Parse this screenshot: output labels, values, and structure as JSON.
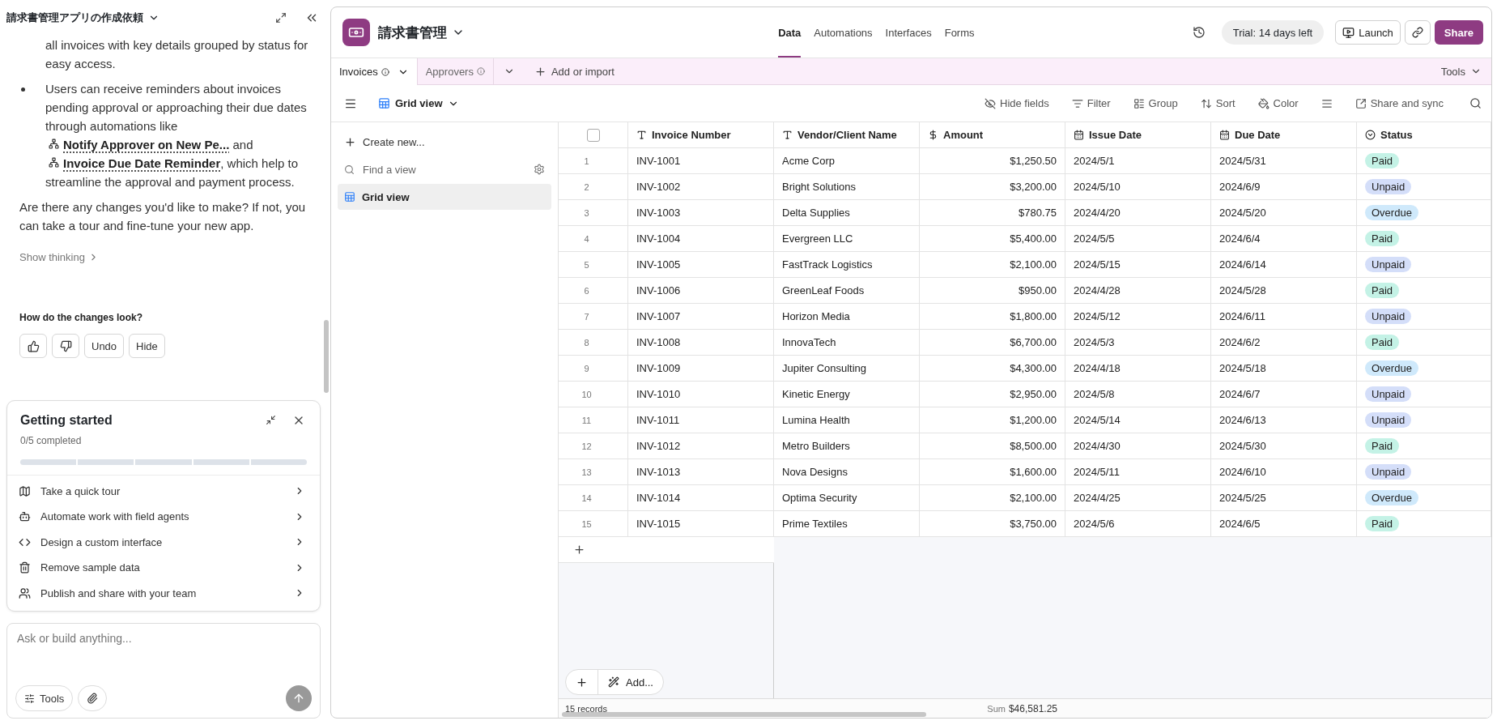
{
  "chat": {
    "title": "請求書管理アプリの作成依頼",
    "continuation_text": "all invoices with key details grouped by status for easy access.",
    "bullet": [
      {
        "kind": "text",
        "text": "Users can receive reminders about invoices pending approval or approaching their due dates through automations like "
      },
      {
        "kind": "link",
        "text": "Notify Approver on New Pe..."
      },
      {
        "kind": "text",
        "text": " and "
      },
      {
        "kind": "link",
        "text": "Invoice Due Date Reminder"
      },
      {
        "kind": "text",
        "text": ", which help to streamline the approval and payment process."
      }
    ],
    "closing": "Are there any changes you'd like to make? If not, you can take a tour and fine-tune your new app.",
    "show_thinking": "Show thinking",
    "feedback_question": "How do the changes look?",
    "feedback_buttons": [
      {
        "kind": "thumbs-up"
      },
      {
        "kind": "thumbs-down"
      },
      {
        "kind": "text",
        "label": "Undo"
      },
      {
        "kind": "text",
        "label": "Hide"
      }
    ]
  },
  "getting_started": {
    "title": "Getting started",
    "progress": "0/5 completed",
    "steps": [
      {
        "kind": "map",
        "label": "Take a quick tour",
        "done": false
      },
      {
        "kind": "bot",
        "label": "Automate work with field agents",
        "done": false
      },
      {
        "kind": "code",
        "label": "Design a custom interface",
        "done": false
      },
      {
        "kind": "trash",
        "label": "Remove sample data",
        "done": false
      },
      {
        "kind": "team",
        "label": "Publish and share with your team",
        "done": false
      }
    ]
  },
  "composer": {
    "placeholder": "Ask or build anything...",
    "tools": "Tools"
  },
  "app": {
    "name": "請求書管理",
    "nav": [
      {
        "label": "Data",
        "selected": true
      },
      {
        "label": "Automations",
        "selected": false
      },
      {
        "label": "Interfaces",
        "selected": false
      },
      {
        "label": "Forms",
        "selected": false
      }
    ],
    "trial": "Trial: 14 days left",
    "launch": "Launch",
    "share": "Share"
  },
  "tables": [
    {
      "label": "Invoices",
      "selected": true
    },
    {
      "label": "Approvers",
      "selected": false
    }
  ],
  "add_or_import": "Add or import",
  "tools": "Tools",
  "toolbar": {
    "view": "Grid view",
    "actions": [
      {
        "kind": "hide",
        "label": "Hide fields"
      },
      {
        "kind": "filter",
        "label": "Filter"
      },
      {
        "kind": "group",
        "label": "Group"
      },
      {
        "kind": "sort",
        "label": "Sort"
      },
      {
        "kind": "color",
        "label": "Color"
      },
      {
        "kind": "height"
      },
      {
        "kind": "share",
        "label": "Share and sync"
      }
    ]
  },
  "views": {
    "create": "Create new...",
    "search_placeholder": "Find a view",
    "items": [
      {
        "label": "Grid view",
        "selected": true
      }
    ]
  },
  "grid": {
    "select_all_checked": false,
    "columns": [
      {
        "kind": "text",
        "label": "Invoice Number"
      },
      {
        "kind": "text",
        "label": "Vendor/Client Name"
      },
      {
        "kind": "currency",
        "label": "Amount"
      },
      {
        "kind": "date",
        "label": "Issue Date"
      },
      {
        "kind": "date",
        "label": "Due Date"
      },
      {
        "kind": "status",
        "label": "Status"
      }
    ],
    "rows": [
      {
        "n": "1",
        "cells": [
          "INV-1001",
          "Acme Corp",
          "$1,250.50",
          "2024/5/1",
          "2024/5/31"
        ],
        "status": {
          "label": "Paid",
          "color": "#c4f2e6"
        }
      },
      {
        "n": "2",
        "cells": [
          "INV-1002",
          "Bright Solutions",
          "$3,200.00",
          "2024/5/10",
          "2024/6/9"
        ],
        "status": {
          "label": "Unpaid",
          "color": "#d4def9"
        }
      },
      {
        "n": "3",
        "cells": [
          "INV-1003",
          "Delta Supplies",
          "$780.75",
          "2024/4/20",
          "2024/5/20"
        ],
        "status": {
          "label": "Overdue",
          "color": "#cfe9fb"
        }
      },
      {
        "n": "4",
        "cells": [
          "INV-1004",
          "Evergreen LLC",
          "$5,400.00",
          "2024/5/5",
          "2024/6/4"
        ],
        "status": {
          "label": "Paid",
          "color": "#c4f2e6"
        }
      },
      {
        "n": "5",
        "cells": [
          "INV-1005",
          "FastTrack Logistics",
          "$2,100.00",
          "2024/5/15",
          "2024/6/14"
        ],
        "status": {
          "label": "Unpaid",
          "color": "#d4def9"
        }
      },
      {
        "n": "6",
        "cells": [
          "INV-1006",
          "GreenLeaf Foods",
          "$950.00",
          "2024/4/28",
          "2024/5/28"
        ],
        "status": {
          "label": "Paid",
          "color": "#c4f2e6"
        }
      },
      {
        "n": "7",
        "cells": [
          "INV-1007",
          "Horizon Media",
          "$1,800.00",
          "2024/5/12",
          "2024/6/11"
        ],
        "status": {
          "label": "Unpaid",
          "color": "#d4def9"
        }
      },
      {
        "n": "8",
        "cells": [
          "INV-1008",
          "InnovaTech",
          "$6,700.00",
          "2024/5/3",
          "2024/6/2"
        ],
        "status": {
          "label": "Paid",
          "color": "#c4f2e6"
        }
      },
      {
        "n": "9",
        "cells": [
          "INV-1009",
          "Jupiter Consulting",
          "$4,300.00",
          "2024/4/18",
          "2024/5/18"
        ],
        "status": {
          "label": "Overdue",
          "color": "#cfe9fb"
        }
      },
      {
        "n": "10",
        "cells": [
          "INV-1010",
          "Kinetic Energy",
          "$2,950.00",
          "2024/5/8",
          "2024/6/7"
        ],
        "status": {
          "label": "Unpaid",
          "color": "#d4def9"
        }
      },
      {
        "n": "11",
        "cells": [
          "INV-1011",
          "Lumina Health",
          "$1,200.00",
          "2024/5/14",
          "2024/6/13"
        ],
        "status": {
          "label": "Unpaid",
          "color": "#d4def9"
        }
      },
      {
        "n": "12",
        "cells": [
          "INV-1012",
          "Metro Builders",
          "$8,500.00",
          "2024/4/30",
          "2024/5/30"
        ],
        "status": {
          "label": "Paid",
          "color": "#c4f2e6"
        }
      },
      {
        "n": "13",
        "cells": [
          "INV-1013",
          "Nova Designs",
          "$1,600.00",
          "2024/5/11",
          "2024/6/10"
        ],
        "status": {
          "label": "Unpaid",
          "color": "#d4def9"
        }
      },
      {
        "n": "14",
        "cells": [
          "INV-1014",
          "Optima Security",
          "$2,100.00",
          "2024/4/25",
          "2024/5/25"
        ],
        "status": {
          "label": "Overdue",
          "color": "#cfe9fb"
        }
      },
      {
        "n": "15",
        "cells": [
          "INV-1015",
          "Prime Textiles",
          "$3,750.00",
          "2024/5/6",
          "2024/6/5"
        ],
        "status": {
          "label": "Paid",
          "color": "#c4f2e6"
        }
      }
    ],
    "add_label": "Add...",
    "records": "15 records",
    "sum_label": "Sum",
    "sum_value": "$46,581.25"
  }
}
